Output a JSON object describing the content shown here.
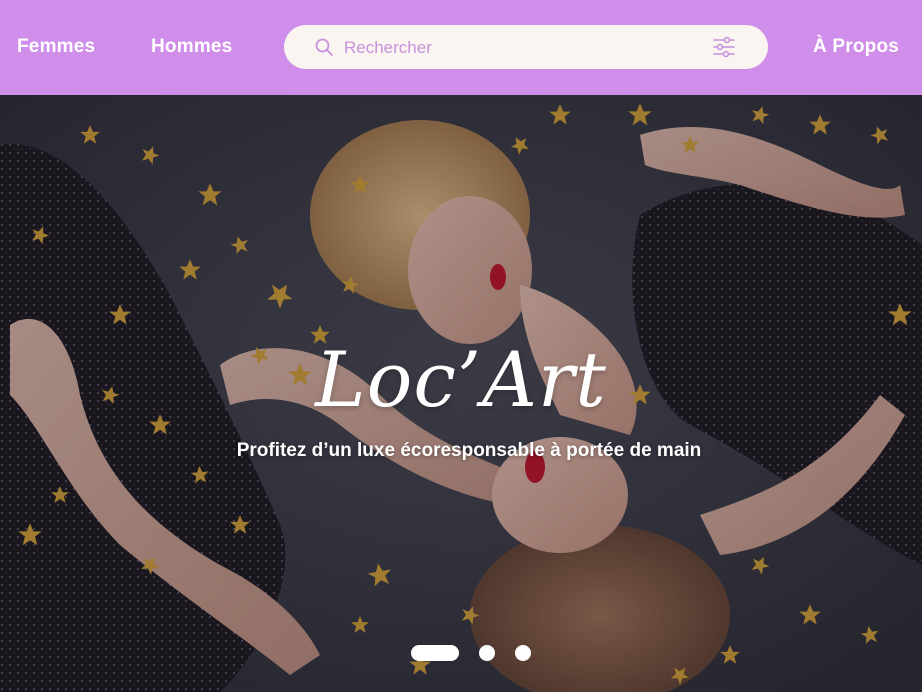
{
  "nav": {
    "women_label": "Femmes",
    "men_label": "Hommes",
    "about_label": "À Propos"
  },
  "search": {
    "placeholder": "Rechercher",
    "value": "",
    "icon": "search-icon",
    "filter_icon": "sliders-icon"
  },
  "hero": {
    "brand": "Loc’Art",
    "tagline": "Profitez d’un luxe écoresponsable à portée de main",
    "carousel": {
      "slide_count": 3,
      "active_index": 0
    }
  },
  "colors": {
    "header_bg": "#cf8eea",
    "search_bg": "#fbf5f1",
    "accent": "#c792dd",
    "text_on_header": "#ffffff"
  }
}
